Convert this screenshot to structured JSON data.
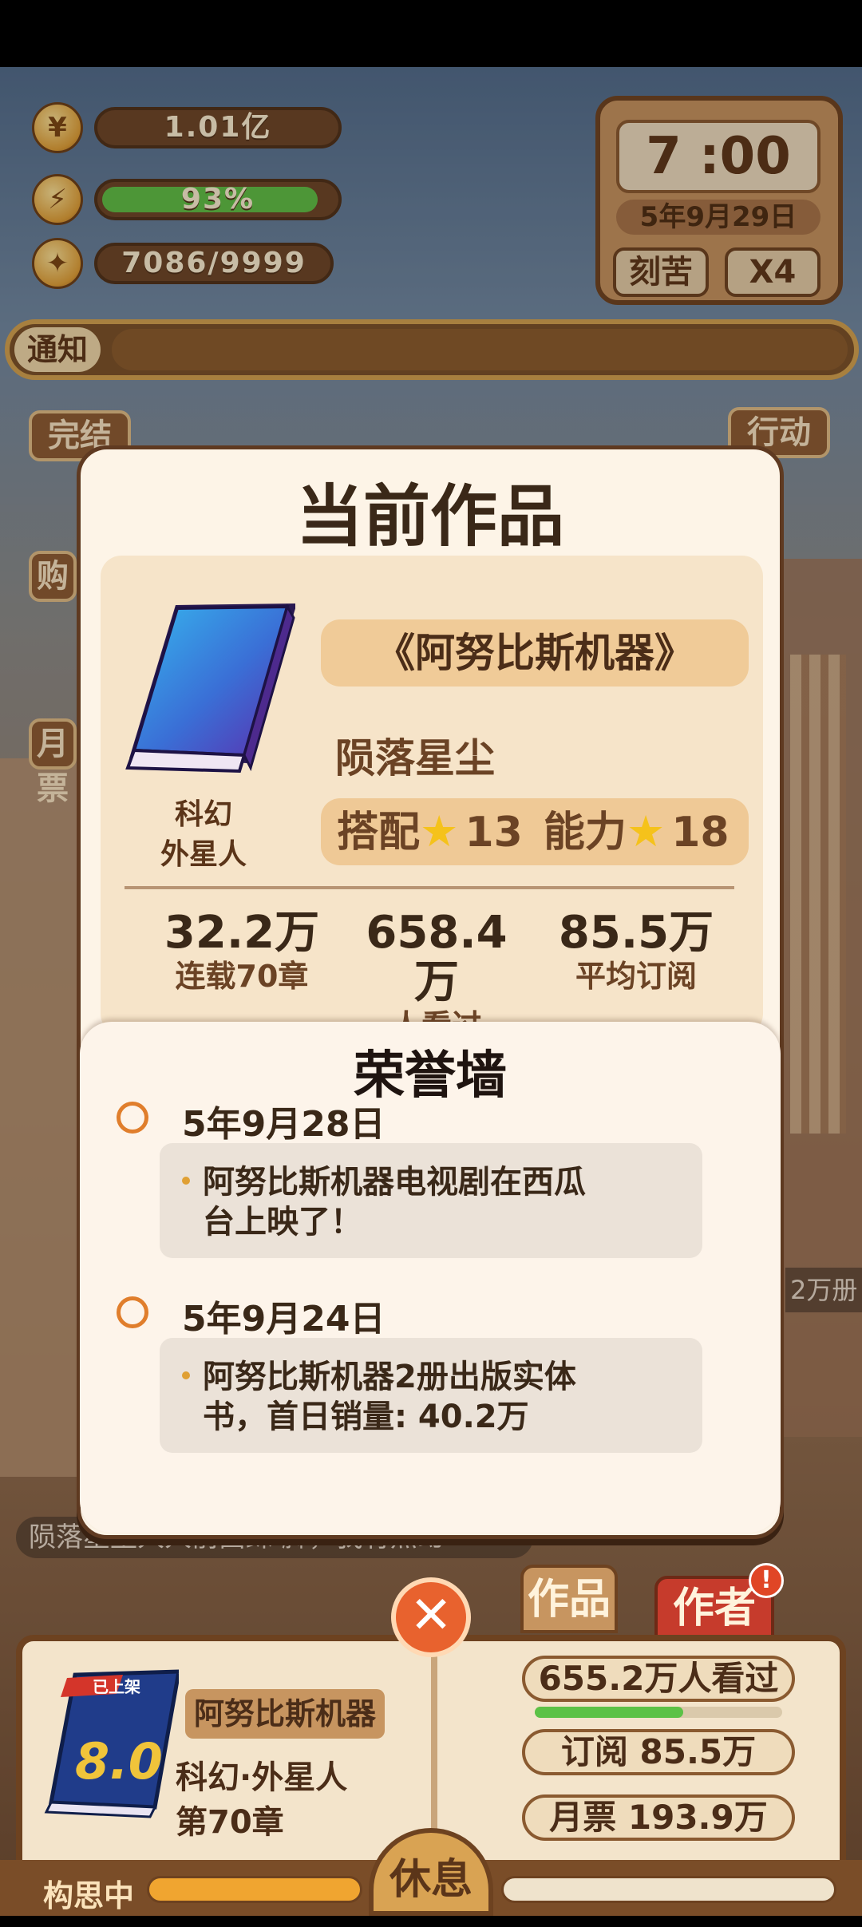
{
  "hud": {
    "coins": "1.01亿",
    "energy_label": "93%",
    "energy_percent": 93,
    "ideas": "7086/9999"
  },
  "clock": {
    "time": "7 :00",
    "date": "5年9月29日",
    "mode_button": "刻苦",
    "speed_button": "X4"
  },
  "notice": {
    "label": "通知"
  },
  "side_buttons": {
    "complete": "完结",
    "action": "行动",
    "buy_partial": "购",
    "monthly_partial": "月票"
  },
  "modal": {
    "title": "当前作品",
    "book_title": "《阿努比斯机器》",
    "author": "陨落星尘",
    "genre_main": "科幻",
    "genre_sub": "外星人",
    "match_label": "搭配",
    "match_value": "13",
    "ability_label": "能力",
    "ability_value": "18",
    "stats": [
      {
        "value": "32.2万",
        "label": "连载70章"
      },
      {
        "value": "658.4万",
        "label": "人看过"
      },
      {
        "value": "85.5万",
        "label": "平均订阅"
      }
    ]
  },
  "honor_wall": {
    "title": "荣誉墙",
    "events": [
      {
        "date": "5年9月28日",
        "text_line1": "阿努比斯机器电视剧在西瓜",
        "text_line2": "台上映了！"
      },
      {
        "date": "5年9月24日",
        "text_line1": "阿努比斯机器2册出版实体",
        "text_line2": "书，首日销量: 40.2万"
      }
    ]
  },
  "close_button": "✕",
  "tabs": {
    "works": "作品",
    "author": "作者",
    "badge": "!"
  },
  "background_text": {
    "ticker": "陨落星尘人人前面踩 脚，我有点幻",
    "bubble": "2万册"
  },
  "bottom_panel": {
    "book_title": "阿努比斯机器",
    "genre": "科幻·外星人",
    "chapter": "第70章",
    "cover_rating": "8.0",
    "cover_ribbon": "已上架",
    "views": "655.2万人看过",
    "views_progress_percent": 60,
    "subscriptions": "订阅 85.5万",
    "monthly_tickets": "月票 193.9万"
  },
  "footer": {
    "thinking": "构思中",
    "rest": "休息"
  },
  "colors": {
    "accent_orange": "#e8622e",
    "energy_green": "#5cc246",
    "star_yellow": "#f5c21b"
  }
}
